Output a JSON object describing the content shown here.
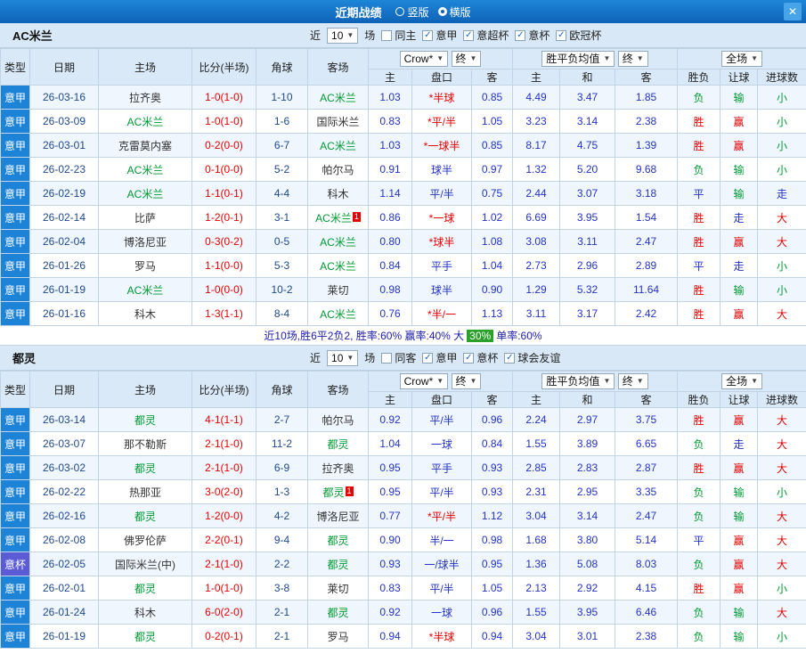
{
  "titlebar": {
    "title": "近期战绩",
    "radios": [
      {
        "label": "竖版",
        "checked": false
      },
      {
        "label": "横版",
        "checked": true
      }
    ],
    "close_label": "✕"
  },
  "table_header": {
    "main_cols": [
      "类型",
      "日期",
      "主场",
      "比分(半场)",
      "角球",
      "客场"
    ],
    "odds_select": "Crow*",
    "odds_final_select": "终",
    "avg_select": "胜平负均值",
    "avg_final_select": "终",
    "scope_select": "全场",
    "sub_cols": [
      "主",
      "盘口",
      "客",
      "主",
      "和",
      "客",
      "胜负",
      "让球",
      "进球数"
    ]
  },
  "sections": [
    {
      "team": "AC米兰",
      "near_label": "近",
      "match_count": "10",
      "games_label": "场",
      "checkboxes": [
        {
          "label": "同主",
          "checked": false
        },
        {
          "label": "意甲",
          "checked": true
        },
        {
          "label": "意超杯",
          "checked": true
        },
        {
          "label": "意杯",
          "checked": true
        },
        {
          "label": "欧冠杯",
          "checked": true
        }
      ],
      "rows": [
        {
          "type": "意甲",
          "date": "26-03-16",
          "home": "拉齐奥",
          "home_focus": false,
          "home_badge": "",
          "score": "1-0(1-0)",
          "corner": "1-10",
          "away": "AC米兰",
          "away_focus": true,
          "away_badge": "",
          "odds_home": "1.03",
          "handicap": "*半球",
          "odds_away": "0.85",
          "avg_home": "4.49",
          "avg_draw": "3.47",
          "avg_away": "1.85",
          "result": "负",
          "handicap_result": "输",
          "goals_result": "小"
        },
        {
          "type": "意甲",
          "date": "26-03-09",
          "home": "AC米兰",
          "home_focus": true,
          "home_badge": "",
          "score": "1-0(1-0)",
          "corner": "1-6",
          "away": "国际米兰",
          "away_focus": false,
          "away_badge": "",
          "odds_home": "0.83",
          "handicap": "*平/半",
          "odds_away": "1.05",
          "avg_home": "3.23",
          "avg_draw": "3.14",
          "avg_away": "2.38",
          "result": "胜",
          "handicap_result": "赢",
          "goals_result": "小"
        },
        {
          "type": "意甲",
          "date": "26-03-01",
          "home": "克雷莫内塞",
          "home_focus": false,
          "home_badge": "",
          "score": "0-2(0-0)",
          "corner": "6-7",
          "away": "AC米兰",
          "away_focus": true,
          "away_badge": "",
          "odds_home": "1.03",
          "handicap": "*一球半",
          "odds_away": "0.85",
          "avg_home": "8.17",
          "avg_draw": "4.75",
          "avg_away": "1.39",
          "result": "胜",
          "handicap_result": "赢",
          "goals_result": "小"
        },
        {
          "type": "意甲",
          "date": "26-02-23",
          "home": "AC米兰",
          "home_focus": true,
          "home_badge": "",
          "score": "0-1(0-0)",
          "corner": "5-2",
          "away": "帕尔马",
          "away_focus": false,
          "away_badge": "",
          "odds_home": "0.91",
          "handicap": "球半",
          "odds_away": "0.97",
          "avg_home": "1.32",
          "avg_draw": "5.20",
          "avg_away": "9.68",
          "result": "负",
          "handicap_result": "输",
          "goals_result": "小"
        },
        {
          "type": "意甲",
          "date": "26-02-19",
          "home": "AC米兰",
          "home_focus": true,
          "home_badge": "",
          "score": "1-1(0-1)",
          "corner": "4-4",
          "away": "科木",
          "away_focus": false,
          "away_badge": "",
          "odds_home": "1.14",
          "handicap": "平/半",
          "odds_away": "0.75",
          "avg_home": "2.44",
          "avg_draw": "3.07",
          "avg_away": "3.18",
          "result": "平",
          "handicap_result": "输",
          "goals_result": "走"
        },
        {
          "type": "意甲",
          "date": "26-02-14",
          "home": "比萨",
          "home_focus": false,
          "home_badge": "",
          "score": "1-2(0-1)",
          "corner": "3-1",
          "away": "AC米兰",
          "away_focus": true,
          "away_badge": "1",
          "odds_home": "0.86",
          "handicap": "*一球",
          "odds_away": "1.02",
          "avg_home": "6.69",
          "avg_draw": "3.95",
          "avg_away": "1.54",
          "result": "胜",
          "handicap_result": "走",
          "goals_result": "大"
        },
        {
          "type": "意甲",
          "date": "26-02-04",
          "home": "博洛尼亚",
          "home_focus": false,
          "home_badge": "",
          "score": "0-3(0-2)",
          "corner": "0-5",
          "away": "AC米兰",
          "away_focus": true,
          "away_badge": "",
          "odds_home": "0.80",
          "handicap": "*球半",
          "odds_away": "1.08",
          "avg_home": "3.08",
          "avg_draw": "3.11",
          "avg_away": "2.47",
          "result": "胜",
          "handicap_result": "赢",
          "goals_result": "大"
        },
        {
          "type": "意甲",
          "date": "26-01-26",
          "home": "罗马",
          "home_focus": false,
          "home_badge": "",
          "score": "1-1(0-0)",
          "corner": "5-3",
          "away": "AC米兰",
          "away_focus": true,
          "away_badge": "",
          "odds_home": "0.84",
          "handicap": "平手",
          "odds_away": "1.04",
          "avg_home": "2.73",
          "avg_draw": "2.96",
          "avg_away": "2.89",
          "result": "平",
          "handicap_result": "走",
          "goals_result": "小"
        },
        {
          "type": "意甲",
          "date": "26-01-19",
          "home": "AC米兰",
          "home_focus": true,
          "home_badge": "",
          "score": "1-0(0-0)",
          "corner": "10-2",
          "away": "莱切",
          "away_focus": false,
          "away_badge": "",
          "odds_home": "0.98",
          "handicap": "球半",
          "odds_away": "0.90",
          "avg_home": "1.29",
          "avg_draw": "5.32",
          "avg_away": "11.64",
          "result": "胜",
          "handicap_result": "输",
          "goals_result": "小"
        },
        {
          "type": "意甲",
          "date": "26-01-16",
          "home": "科木",
          "home_focus": false,
          "home_badge": "",
          "score": "1-3(1-1)",
          "corner": "8-4",
          "away": "AC米兰",
          "away_focus": true,
          "away_badge": "",
          "odds_home": "0.76",
          "handicap": "*半/一",
          "odds_away": "1.13",
          "avg_home": "3.11",
          "avg_draw": "3.17",
          "avg_away": "2.42",
          "result": "胜",
          "handicap_result": "赢",
          "goals_result": "大"
        }
      ],
      "summary": {
        "before": "近10场,胜6平2负2, 胜率:60% 赢率:40% 大 ",
        "badge": "30%",
        "after": " 单率:60%"
      }
    },
    {
      "team": "都灵",
      "near_label": "近",
      "match_count": "10",
      "games_label": "场",
      "checkboxes": [
        {
          "label": "同客",
          "checked": false
        },
        {
          "label": "意甲",
          "checked": true
        },
        {
          "label": "意杯",
          "checked": true
        },
        {
          "label": "球会友谊",
          "checked": true
        }
      ],
      "rows": [
        {
          "type": "意甲",
          "date": "26-03-14",
          "home": "都灵",
          "home_focus": true,
          "home_badge": "",
          "score": "4-1(1-1)",
          "corner": "2-7",
          "away": "帕尔马",
          "away_focus": false,
          "away_badge": "",
          "odds_home": "0.92",
          "handicap": "平/半",
          "odds_away": "0.96",
          "avg_home": "2.24",
          "avg_draw": "2.97",
          "avg_away": "3.75",
          "result": "胜",
          "handicap_result": "赢",
          "goals_result": "大"
        },
        {
          "type": "意甲",
          "date": "26-03-07",
          "home": "那不勒斯",
          "home_focus": false,
          "home_badge": "",
          "score": "2-1(1-0)",
          "corner": "11-2",
          "away": "都灵",
          "away_focus": true,
          "away_badge": "",
          "odds_home": "1.04",
          "handicap": "一球",
          "odds_away": "0.84",
          "avg_home": "1.55",
          "avg_draw": "3.89",
          "avg_away": "6.65",
          "result": "负",
          "handicap_result": "走",
          "goals_result": "大"
        },
        {
          "type": "意甲",
          "date": "26-03-02",
          "home": "都灵",
          "home_focus": true,
          "home_badge": "",
          "score": "2-1(1-0)",
          "corner": "6-9",
          "away": "拉齐奥",
          "away_focus": false,
          "away_badge": "",
          "odds_home": "0.95",
          "handicap": "平手",
          "odds_away": "0.93",
          "avg_home": "2.85",
          "avg_draw": "2.83",
          "avg_away": "2.87",
          "result": "胜",
          "handicap_result": "赢",
          "goals_result": "大"
        },
        {
          "type": "意甲",
          "date": "26-02-22",
          "home": "热那亚",
          "home_focus": false,
          "home_badge": "",
          "score": "3-0(2-0)",
          "corner": "1-3",
          "away": "都灵",
          "away_focus": true,
          "away_badge": "1",
          "odds_home": "0.95",
          "handicap": "平/半",
          "odds_away": "0.93",
          "avg_home": "2.31",
          "avg_draw": "2.95",
          "avg_away": "3.35",
          "result": "负",
          "handicap_result": "输",
          "goals_result": "小"
        },
        {
          "type": "意甲",
          "date": "26-02-16",
          "home": "都灵",
          "home_focus": true,
          "home_badge": "",
          "score": "1-2(0-0)",
          "corner": "4-2",
          "away": "博洛尼亚",
          "away_focus": false,
          "away_badge": "",
          "odds_home": "0.77",
          "handicap": "*平/半",
          "odds_away": "1.12",
          "avg_home": "3.04",
          "avg_draw": "3.14",
          "avg_away": "2.47",
          "result": "负",
          "handicap_result": "输",
          "goals_result": "大"
        },
        {
          "type": "意甲",
          "date": "26-02-08",
          "home": "佛罗伦萨",
          "home_focus": false,
          "home_badge": "",
          "score": "2-2(0-1)",
          "corner": "9-4",
          "away": "都灵",
          "away_focus": true,
          "away_badge": "",
          "odds_home": "0.90",
          "handicap": "半/一",
          "odds_away": "0.98",
          "avg_home": "1.68",
          "avg_draw": "3.80",
          "avg_away": "5.14",
          "result": "平",
          "handicap_result": "赢",
          "goals_result": "大"
        },
        {
          "type": "意杯",
          "date": "26-02-05",
          "home": "国际米兰(中)",
          "home_focus": false,
          "home_badge": "",
          "score": "2-1(1-0)",
          "corner": "2-2",
          "away": "都灵",
          "away_focus": true,
          "away_badge": "",
          "odds_home": "0.93",
          "handicap": "一/球半",
          "odds_away": "0.95",
          "avg_home": "1.36",
          "avg_draw": "5.08",
          "avg_away": "8.03",
          "result": "负",
          "handicap_result": "赢",
          "goals_result": "大"
        },
        {
          "type": "意甲",
          "date": "26-02-01",
          "home": "都灵",
          "home_focus": true,
          "home_badge": "",
          "score": "1-0(1-0)",
          "corner": "3-8",
          "away": "莱切",
          "away_focus": false,
          "away_badge": "",
          "odds_home": "0.83",
          "handicap": "平/半",
          "odds_away": "1.05",
          "avg_home": "2.13",
          "avg_draw": "2.92",
          "avg_away": "4.15",
          "result": "胜",
          "handicap_result": "赢",
          "goals_result": "小"
        },
        {
          "type": "意甲",
          "date": "26-01-24",
          "home": "科木",
          "home_focus": false,
          "home_badge": "",
          "score": "6-0(2-0)",
          "corner": "2-1",
          "away": "都灵",
          "away_focus": true,
          "away_badge": "",
          "odds_home": "0.92",
          "handicap": "一球",
          "odds_away": "0.96",
          "avg_home": "1.55",
          "avg_draw": "3.95",
          "avg_away": "6.46",
          "result": "负",
          "handicap_result": "输",
          "goals_result": "大"
        },
        {
          "type": "意甲",
          "date": "26-01-19",
          "home": "都灵",
          "home_focus": true,
          "home_badge": "",
          "score": "0-2(0-1)",
          "corner": "2-1",
          "away": "罗马",
          "away_focus": false,
          "away_badge": "",
          "odds_home": "0.94",
          "handicap": "*半球",
          "odds_away": "0.94",
          "avg_home": "3.04",
          "avg_draw": "3.01",
          "avg_away": "2.38",
          "result": "负",
          "handicap_result": "输",
          "goals_result": "小"
        }
      ],
      "summary": null
    }
  ]
}
